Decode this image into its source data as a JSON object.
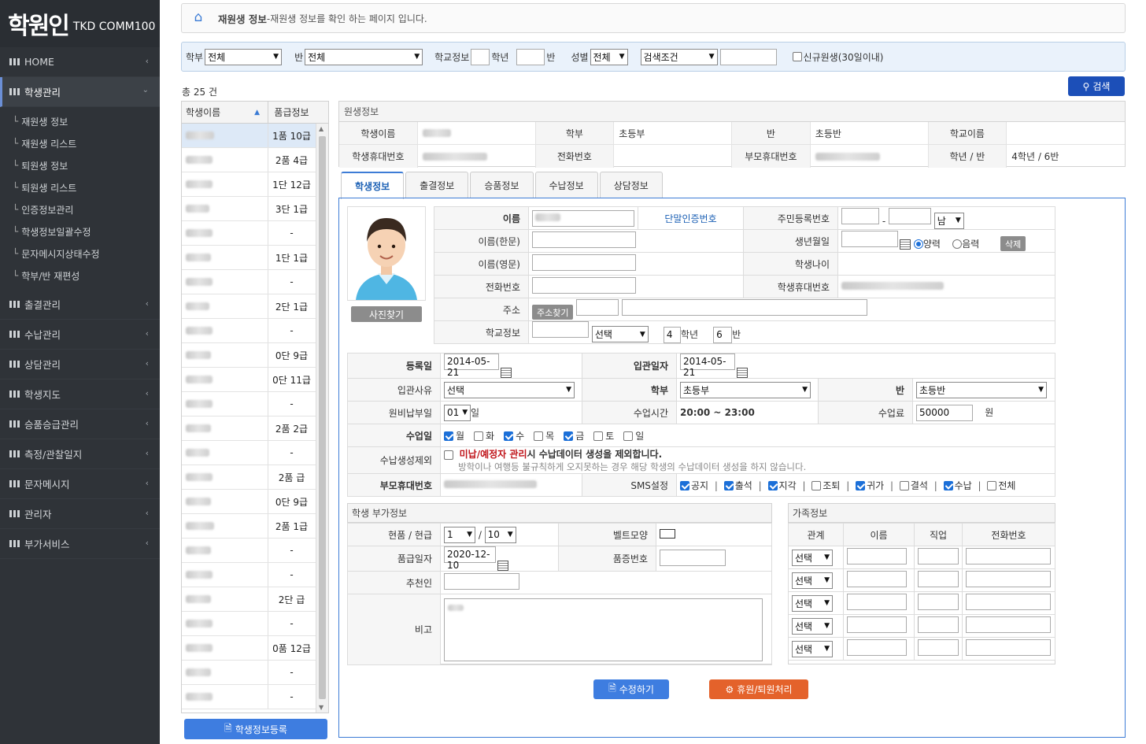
{
  "logo": {
    "main": "학원인",
    "sub": "TKD COMM100"
  },
  "menu": {
    "home": "HOME",
    "student": "학생관리",
    "sub": [
      "재원생 정보",
      "재원생 리스트",
      "퇴원생 정보",
      "퇴원생 리스트",
      "인증정보관리",
      "학생정보일괄수정",
      "문자메시지상태수정",
      "학부/반 재편성"
    ],
    "others": [
      "출결관리",
      "수납관리",
      "상담관리",
      "학생지도",
      "승품승급관리",
      "측정/관찰일지",
      "문자메시지",
      "관리자",
      "부가서비스"
    ]
  },
  "breadcrumb": {
    "title": "재원생 정보",
    "desc": " -재원생 정보를 확인 하는 페이지 입니다."
  },
  "filter": {
    "dept_label": "학부",
    "dept": "전체",
    "class_label": "반",
    "class": "전체",
    "school_label": "학교정보",
    "grade_label": "학년",
    "ban_label": "반",
    "gender_label": "성별",
    "gender": "전체",
    "cond": "검색조건",
    "new_label": "신규원생(30일이내)"
  },
  "total": "총 25 건",
  "search_btn": "검색",
  "list": {
    "h_name": "학생이름",
    "h_grade": "품급정보",
    "grades": [
      "1품 10급",
      "2품 4급",
      "1단 12급",
      "3단 1급",
      "-",
      "1단 1급",
      "-",
      "2단 1급",
      "-",
      "0단 9급",
      "0단 11급",
      "-",
      "2품 2급",
      "-",
      "2품 급",
      "0단 9급",
      "2품 1급",
      "-",
      "-",
      "2단 급",
      "-",
      "0품 12급",
      "-",
      "-"
    ]
  },
  "reg_btn": "학생정보등록",
  "info": {
    "title": "원생정보",
    "k_name": "학생이름",
    "k_dept": "학부",
    "v_dept": "초등부",
    "k_class": "반",
    "v_class": "초등반",
    "k_school": "학교이름",
    "k_phone": "학생휴대번호",
    "k_tel": "전화번호",
    "k_pphone": "부모휴대번호",
    "k_gb": "학년 / 반",
    "v_gb": "4학년 / 6반"
  },
  "tabs": [
    "학생정보",
    "출결정보",
    "승품정보",
    "수납정보",
    "상담정보"
  ],
  "photo_btn": "사진찾기",
  "form": {
    "name": "이름",
    "auth": "단말인증번호",
    "rrn": "주민등록번호",
    "gender": "남",
    "hanja": "이름(한문)",
    "birth": "생년월일",
    "solar": "양력",
    "lunar": "음력",
    "del": "삭제",
    "eng": "이름(영문)",
    "age": "학생나이",
    "tel": "전화번호",
    "sphone": "학생휴대번호",
    "addr": "주소",
    "addr_btn": "주소찾기",
    "school": "학교정보",
    "school_sel": "선택",
    "grade": "4",
    "grade_u": "학년",
    "ban": "6",
    "ban_u": "반"
  },
  "form2": {
    "reg": "등록일",
    "reg_v": "2014-05-21",
    "join": "입관일자",
    "join_v": "2014-05-21",
    "reason": "입관사유",
    "reason_v": "선택",
    "dept": "학부",
    "dept_v": "초등부",
    "cls": "반",
    "cls_v": "초등반",
    "payday": "원비납부일",
    "payday_v": "01",
    "payday_u": "일",
    "time": "수업시간",
    "time_v": "20:00 ~ 23:00",
    "fee": "수업료",
    "fee_v": "50000",
    "fee_u": "원",
    "days": "수업일",
    "day_list": [
      "월",
      "화",
      "수",
      "목",
      "금",
      "토",
      "일"
    ],
    "excl": "수납생성제외",
    "excl_red": "미납/예정자 관리",
    "excl_txt": "시 수납데이터 생성을 제외합니다.",
    "excl_sub": "방학이나 여행등 불규칙하게 오지못하는 경우 해당 학생의 수납데이터 생성을 하지 않습니다.",
    "pphone": "부모휴대번호",
    "sms": "SMS설정",
    "sms_list": [
      "공지",
      "출석",
      "지각",
      "조퇴",
      "귀가",
      "결석",
      "수납",
      "전체"
    ]
  },
  "extra": {
    "title": "학생 부가정보",
    "belt": "현품 / 현급",
    "belt_a": "1",
    "belt_b": "10",
    "shape": "벨트모양",
    "date": "품급일자",
    "date_v": "2020-12-10",
    "certno": "품증번호",
    "rec": "추천인",
    "memo": "비고"
  },
  "family": {
    "title": "가족정보",
    "h": [
      "관계",
      "이름",
      "직업",
      "전화번호"
    ],
    "sel": "선택"
  },
  "btns": {
    "edit": "수정하기",
    "leave": "휴원/퇴원처리"
  }
}
